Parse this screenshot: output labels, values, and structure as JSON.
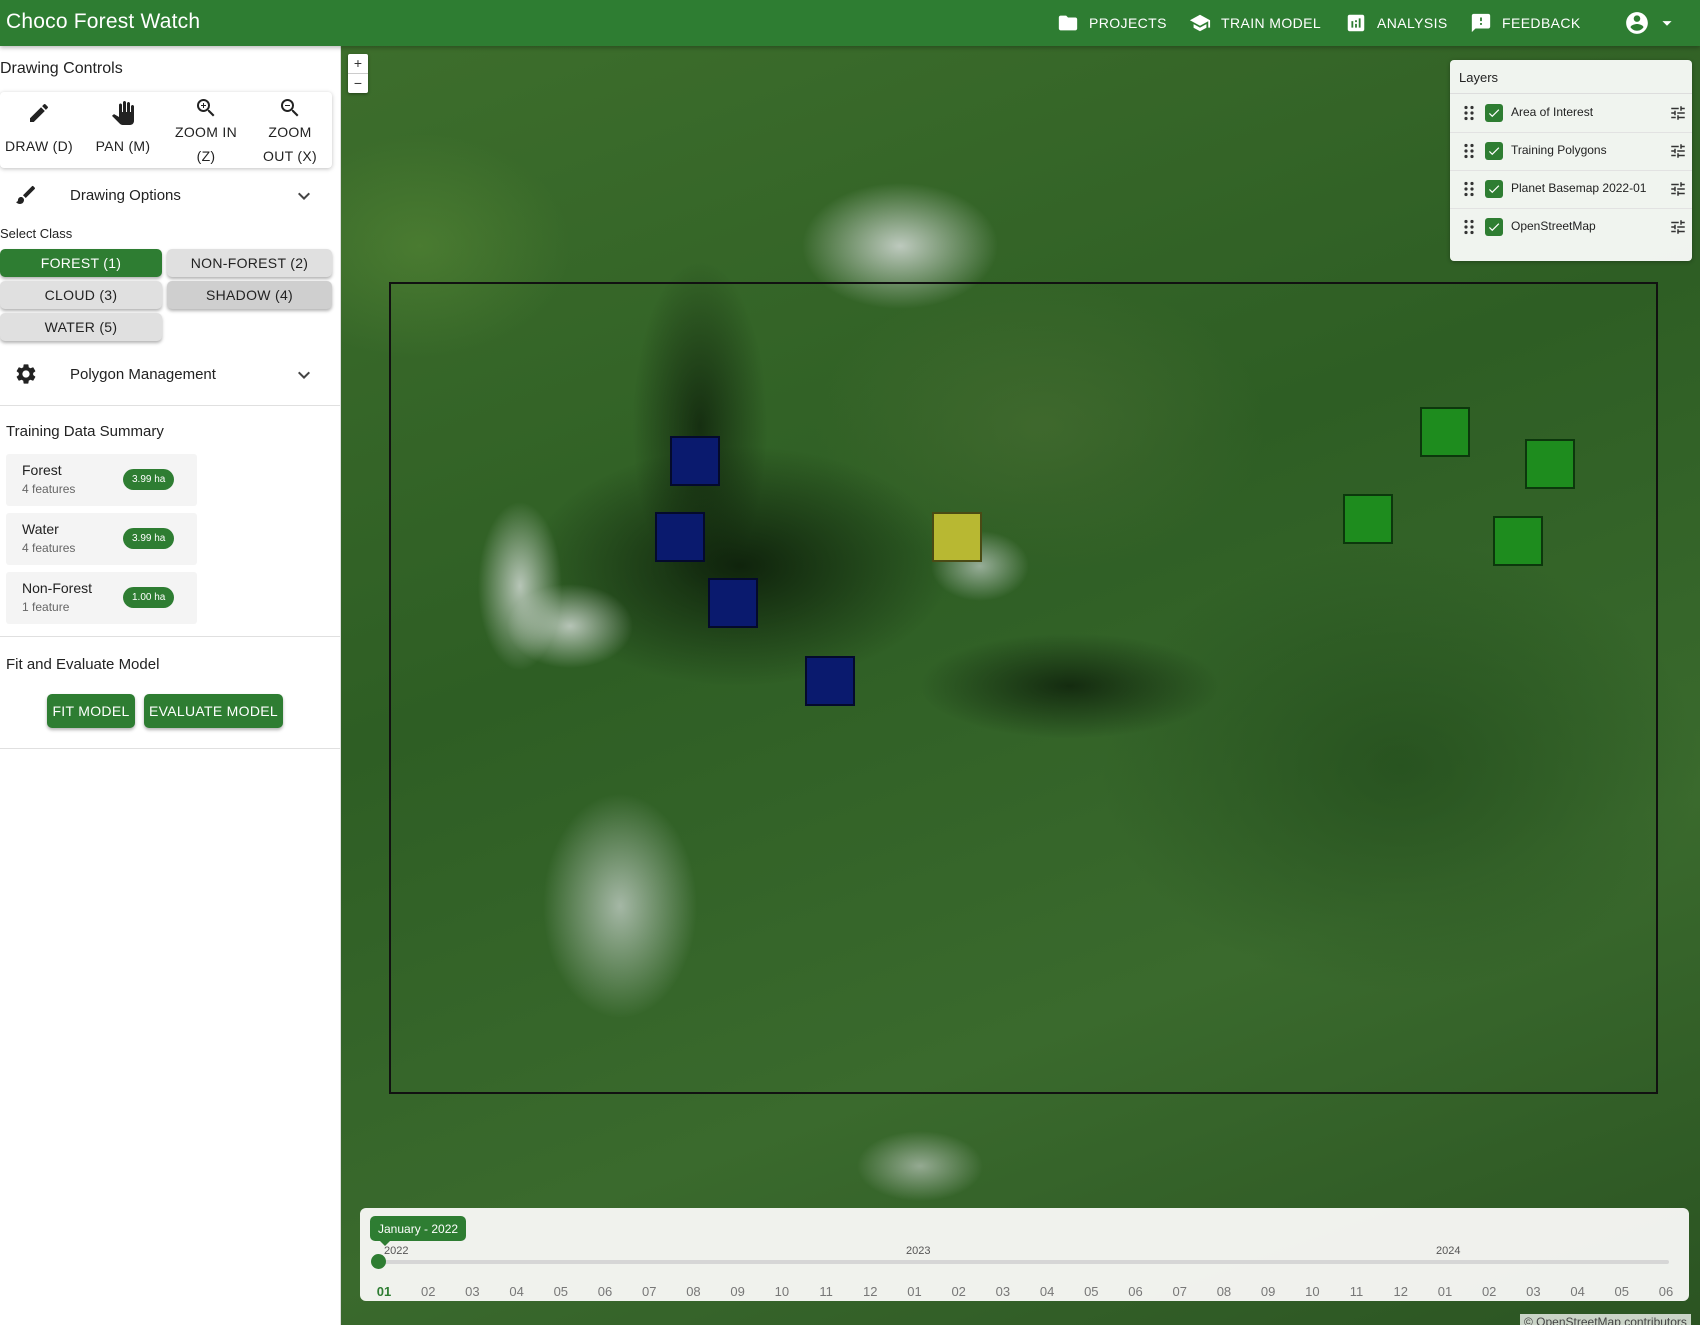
{
  "app": {
    "title": "Choco Forest Watch"
  },
  "nav": {
    "projects": "PROJECTS",
    "train_model": "TRAIN MODEL",
    "analysis": "ANALYSIS",
    "feedback": "FEEDBACK"
  },
  "sidebar": {
    "drawing_controls_title": "Drawing Controls",
    "tools": [
      {
        "label": "DRAW (D)",
        "icon": "pencil-icon"
      },
      {
        "label": "PAN (M)",
        "icon": "hand-icon"
      },
      {
        "label": "ZOOM IN (Z)",
        "icon": "zoom-in-icon"
      },
      {
        "label": "ZOOM OUT (X)",
        "icon": "zoom-out-icon"
      }
    ],
    "drawing_options": "Drawing Options",
    "select_class_title": "Select Class",
    "classes": [
      "FOREST (1)",
      "NON-FOREST (2)",
      "CLOUD (3)",
      "SHADOW (4)",
      "WATER (5)"
    ],
    "selected_class": "FOREST (1)",
    "polygon_management": "Polygon Management",
    "training_summary_title": "Training Data Summary",
    "summary": [
      {
        "name": "Forest",
        "count": "4 features",
        "area": "3.99 ha"
      },
      {
        "name": "Water",
        "count": "4 features",
        "area": "3.99 ha"
      },
      {
        "name": "Non-Forest",
        "count": "1 feature",
        "area": "1.00 ha"
      }
    ],
    "fit_title": "Fit and Evaluate Model",
    "fit_button": "FIT MODEL",
    "evaluate_button": "EVALUATE MODEL"
  },
  "map": {
    "zoom_in": "+",
    "zoom_out": "−",
    "polygon_colors": {
      "forest": "#1e8c1e",
      "water": "#0a1a6e",
      "non_forest": "#b8b832"
    },
    "attribution": "© OpenStreetMap contributors"
  },
  "layers": {
    "title": "Layers",
    "items": [
      {
        "name": "Area of Interest",
        "checked": true
      },
      {
        "name": "Training Polygons",
        "checked": true
      },
      {
        "name": "Planet Basemap 2022-01",
        "checked": true
      },
      {
        "name": "OpenStreetMap",
        "checked": true
      }
    ]
  },
  "timeline": {
    "tooltip": "January - 2022",
    "years": [
      "2022",
      "2023",
      "2024"
    ],
    "months": [
      "01",
      "02",
      "03",
      "04",
      "05",
      "06",
      "07",
      "08",
      "09",
      "10",
      "11",
      "12",
      "01",
      "02",
      "03",
      "04",
      "05",
      "06",
      "07",
      "08",
      "09",
      "10",
      "11",
      "12",
      "01",
      "02",
      "03",
      "04",
      "05",
      "06"
    ],
    "selected_index": 0
  },
  "colors": {
    "brand": "#2e7d32"
  }
}
